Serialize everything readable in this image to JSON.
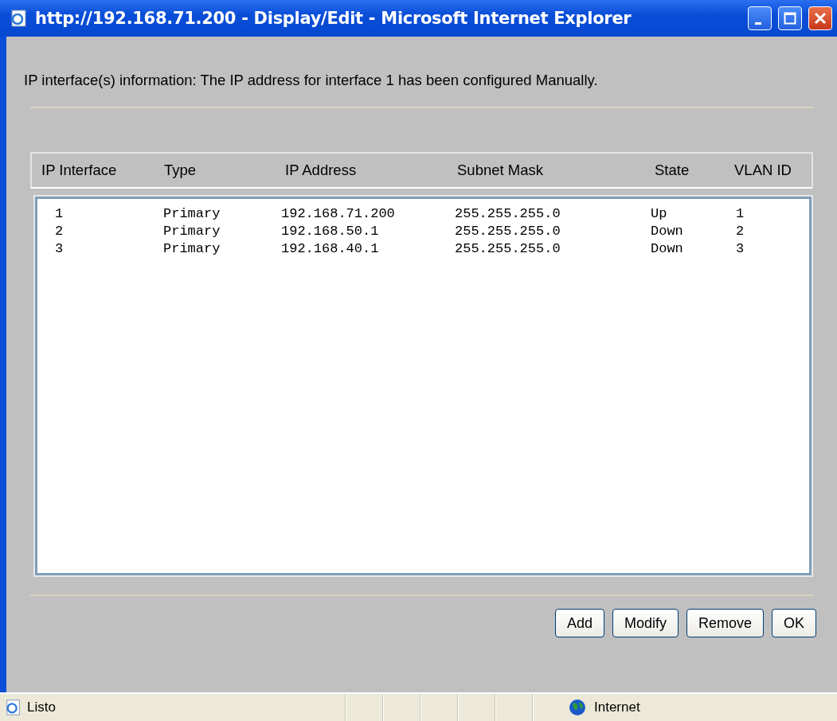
{
  "window": {
    "title": "http://192.168.71.200 - Display/Edit - Microsoft Internet Explorer"
  },
  "info": "IP interface(s) information: The IP address for interface 1 has been configured Manually.",
  "table": {
    "columns": [
      "IP Interface",
      "Type",
      "IP Address",
      "Subnet Mask",
      "State",
      "VLAN ID"
    ],
    "rows": [
      [
        "1",
        "Primary",
        "192.168.71.200",
        "255.255.255.0",
        "Up",
        "1"
      ],
      [
        "2",
        "Primary",
        "192.168.50.1",
        "255.255.255.0",
        "Down",
        "2"
      ],
      [
        "3",
        "Primary",
        "192.168.40.1",
        "255.255.255.0",
        "Down",
        "3"
      ]
    ]
  },
  "buttons": [
    "Add",
    "Modify",
    "Remove",
    "OK"
  ],
  "status_bar": {
    "text": "Listo",
    "zone": "Internet"
  }
}
